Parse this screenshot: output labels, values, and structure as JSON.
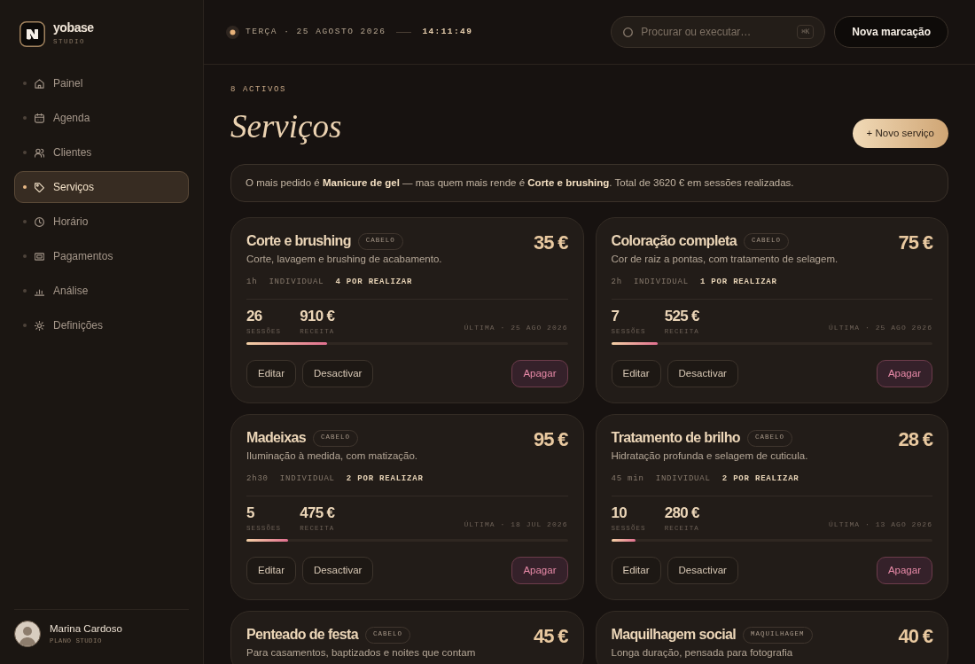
{
  "sidebar": {
    "brand": {
      "name": "yobase",
      "subtitle": "STUDIO"
    },
    "items": [
      {
        "label": "Painel",
        "selected": false
      },
      {
        "label": "Agenda",
        "selected": false
      },
      {
        "label": "Clientes",
        "selected": false
      },
      {
        "label": "Serviços",
        "selected": true
      },
      {
        "label": "Horário",
        "selected": false
      },
      {
        "label": "Pagamentos",
        "selected": false
      },
      {
        "label": "Análise",
        "selected": false
      },
      {
        "label": "Definições",
        "selected": false
      }
    ],
    "user": {
      "name": "Marina Cardoso",
      "plan": "PLANO STUDIO"
    }
  },
  "header": {
    "date": "TERÇA · 25 AGOSTO 2026",
    "time": "14:11:49",
    "search": {
      "placeholder": "Procurar ou executar…",
      "shortcut": "⌘K"
    },
    "button": "Nova marcação"
  },
  "page": {
    "count": "8 ACTIVOS",
    "title": "Serviços",
    "button": "+ Novo serviço",
    "summary": "O mais pedido é **Manicure de gel** — mas quem mais rende é **Corte e brushing**. Total de 3620 € em sessões realizadas."
  },
  "services": [
    {
      "name": "Corte e brushing",
      "category": "CABELO",
      "price": "35 €",
      "description": "Corte, lavagem e brushing de acabamento.",
      "duration": "1h",
      "mode": "INDIVIDUAL",
      "pending": "4 POR REALIZAR",
      "stats": [
        {
          "value": "26",
          "label": "SESSÕES"
        },
        {
          "value": "910 €",
          "label": "RECEITA"
        }
      ],
      "last": "ÚLTIMA · 25 AGO 2026",
      "level": 0.25,
      "actions": [
        {
          "label": "Editar",
          "kind": "default"
        },
        {
          "label": "Desactivar",
          "kind": "default"
        },
        {
          "label": "Apagar",
          "kind": "danger"
        }
      ]
    },
    {
      "name": "Coloração completa",
      "category": "CABELO",
      "price": "75 €",
      "description": "Cor de raiz a pontas, com tratamento de selagem.",
      "duration": "2h",
      "mode": "INDIVIDUAL",
      "pending": "1 POR REALIZAR",
      "stats": [
        {
          "value": "7",
          "label": "SESSÕES"
        },
        {
          "value": "525 €",
          "label": "RECEITA"
        }
      ],
      "last": "ÚLTIMA · 25 AGO 2026",
      "level": 0.145,
      "actions": [
        {
          "label": "Editar",
          "kind": "default"
        },
        {
          "label": "Desactivar",
          "kind": "default"
        },
        {
          "label": "Apagar",
          "kind": "danger"
        }
      ]
    },
    {
      "name": "Madeixas",
      "category": "CABELO",
      "price": "95 €",
      "description": "Iluminação à medida, com matização.",
      "duration": "2h30",
      "mode": "INDIVIDUAL",
      "pending": "2 POR REALIZAR",
      "stats": [
        {
          "value": "5",
          "label": "SESSÕES"
        },
        {
          "value": "475 €",
          "label": "RECEITA"
        }
      ],
      "last": "ÚLTIMA · 18 JUL 2026",
      "level": 0.13,
      "actions": [
        {
          "label": "Editar",
          "kind": "default"
        },
        {
          "label": "Desactivar",
          "kind": "default"
        },
        {
          "label": "Apagar",
          "kind": "danger"
        }
      ]
    },
    {
      "name": "Tratamento de brilho",
      "category": "CABELO",
      "price": "28 €",
      "description": "Hidratação profunda e selagem de cuticula.",
      "duration": "45 min",
      "mode": "INDIVIDUAL",
      "pending": "2 POR REALIZAR",
      "stats": [
        {
          "value": "10",
          "label": "SESSÕES"
        },
        {
          "value": "280 €",
          "label": "RECEITA"
        }
      ],
      "last": "ÚLTIMA · 13 AGO 2026",
      "level": 0.077,
      "actions": [
        {
          "label": "Editar",
          "kind": "default"
        },
        {
          "label": "Desactivar",
          "kind": "default"
        },
        {
          "label": "Apagar",
          "kind": "danger"
        }
      ]
    },
    {
      "name": "Penteado de festa",
      "category": "CABELO",
      "price": "45 €",
      "description": "Para casamentos, baptizados e noites que contam"
    },
    {
      "name": "Maquilhagem social",
      "category": "MAQUILHAGEM",
      "price": "40 €",
      "description": "Longa duração, pensada para fotografia"
    }
  ]
}
